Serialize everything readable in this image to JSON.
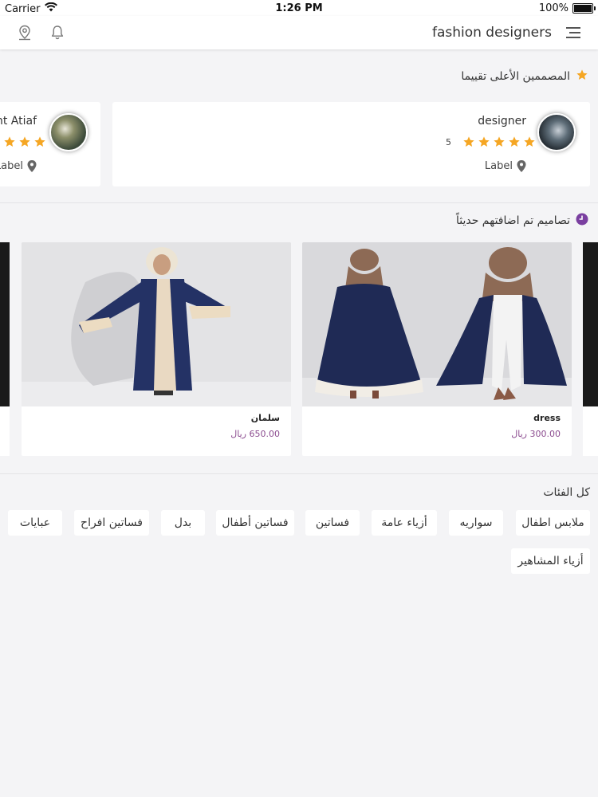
{
  "status_bar": {
    "carrier": "Carrier",
    "time": "1:26 PM",
    "battery": "100%",
    "battery_level": 1.0
  },
  "navbar": {
    "title": "fashion designers",
    "icons": [
      "menu-icon",
      "location-pin-icon",
      "bell-icon"
    ]
  },
  "top_rated": {
    "title": "المصممين الأعلى تقييما",
    "icon": "star-icon",
    "designers": [
      {
        "name": "designer",
        "rating": 5,
        "rating_text": "5",
        "location": "Label"
      },
      {
        "name": "nt Atiaf",
        "rating": 5,
        "location": "Label"
      }
    ]
  },
  "recent": {
    "title": "تصاميم تم اضافتهم حديثاً",
    "icon": "clock-icon",
    "products": [
      {
        "name": "dress",
        "price": "300.00 ريال"
      },
      {
        "name": "سلمان",
        "price": "650.00 ريال"
      }
    ]
  },
  "categories": {
    "title": "كل الفئات",
    "items": [
      "ملابس اطفال",
      "سواريه",
      "أزياء عامة",
      "فساتين",
      "فساتين أطفال",
      "بدل",
      "فساتين افراح",
      "عبايات",
      "أزياء المشاهير"
    ]
  },
  "colors": {
    "accent_star": "#f5a623",
    "clock": "#7a3fa0",
    "price": "#8b4b8f"
  }
}
